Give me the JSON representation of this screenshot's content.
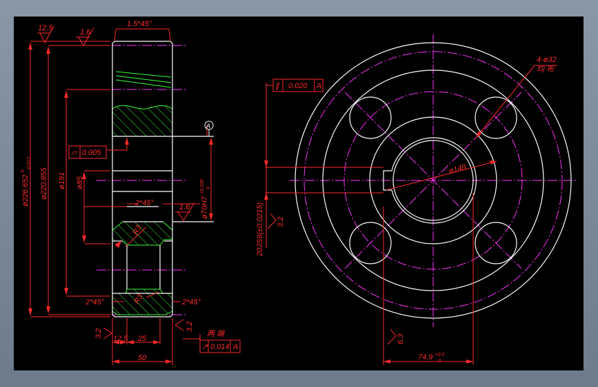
{
  "drawing": {
    "colors": {
      "background": "#000000",
      "outline": "#ffffff",
      "dimension": "#ff2a2a",
      "centerline": "#ff33ff",
      "hatch": "#39ff39"
    },
    "side_view": {
      "roughness_top_left": "12.5",
      "roughness_top": "1.6",
      "chamfer_top": "1.5*45°",
      "dia_outer": "ø226.652",
      "dia_outer_tol_upper": "0",
      "dia_outer_tol_lower": "-0.072",
      "dia_root": "ø220.855",
      "dia_hub": "ø191",
      "dia_bore": "ø85",
      "flatness_symbol": "▱",
      "flatness_value": "0.005",
      "datum_label": "A",
      "bore_fit": "ø70H7",
      "bore_fit_tol_upper": "+0.030",
      "bore_fit_tol_lower": "0",
      "chamfer_mid": "2*45°",
      "roughness_mid": "1.6",
      "chamfer_bottom_left": "2*45°",
      "chamfer_bottom_right": "2*45°",
      "label_r3_top": "R3",
      "label_r3_bottom": "R3",
      "roughness_bottom_left": "3.2",
      "roughness_bottom_right": "3.2",
      "dim_12_5": "12.5",
      "dim_25": "25",
      "dim_50": "50",
      "note_both_ends": "两 端",
      "runout_symbol": "↗",
      "runout_value": "0.014",
      "runout_datum": "A"
    },
    "front_view": {
      "holes_label": "4-ø32",
      "holes_note": "均 布",
      "parallel_symbol": "∥",
      "parallel_value": "0.020",
      "parallel_datum": "A",
      "keyway_dim": "20JS9(±0.0215)",
      "roughness_key": "3.2",
      "dia_pcd": "ø148",
      "roughness_key_bottom": "6.3",
      "key_depth": "74.9",
      "key_depth_tol_upper": "+0.2",
      "key_depth_tol_lower": "0"
    }
  }
}
